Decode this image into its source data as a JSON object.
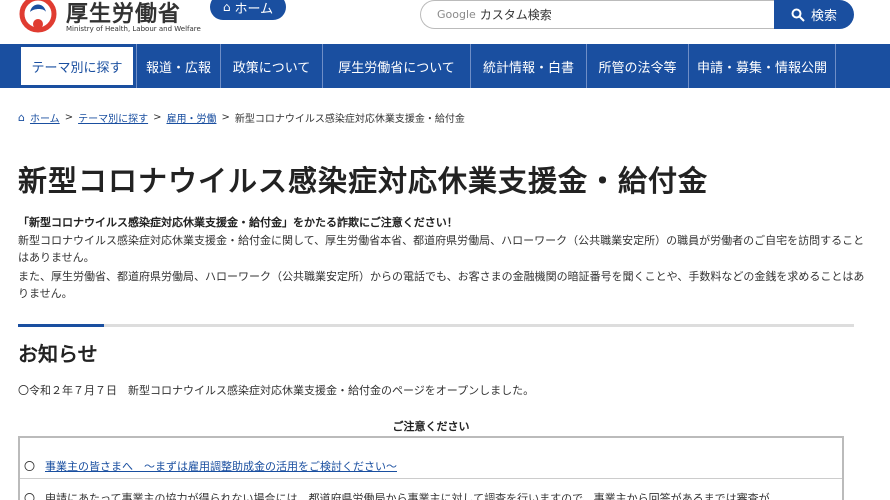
{
  "header": {
    "logo_text": "厚生労働省",
    "logo_sub": "Ministry of Health, Labour and Welfare",
    "home_label": "ホーム",
    "search_placeholder_brand": "Google",
    "search_placeholder": "カスタム検索",
    "search_button": "検索"
  },
  "gnav": {
    "items": [
      {
        "label": "テーマ別に探す"
      },
      {
        "label": "報道・広報"
      },
      {
        "label": "政策について"
      },
      {
        "label": "厚生労働省について"
      },
      {
        "label": "統計情報・白書"
      },
      {
        "label": "所管の法令等"
      },
      {
        "label": "申請・募集・情報公開"
      }
    ]
  },
  "breadcrumb": {
    "items": [
      "ホーム",
      "テーマ別に探す",
      "雇用・労働"
    ],
    "current": "新型コロナウイルス感染症対応休業支援金・給付金",
    "separator": ">"
  },
  "main": {
    "title": "新型コロナウイルス感染症対応休業支援金・給付金",
    "warning_heading": "「新型コロナウイルス感染症対応休業支援金・給付金」をかたる詐欺にご注意ください！",
    "warning_para1": "新型コロナウイルス感染症対応休業支援金・給付金に関して、厚生労働省本省、都道府県労働局、ハローワーク（公共職業安定所）の職員が労働者のご自宅を訪問することはありません。",
    "warning_para2": "また、厚生労働省、都道府県労働局、ハローワーク（公共職業安定所）からの電話でも、お客さまの金融機関の暗証番号を聞くことや、手数料などの金銭を求めることはありません。",
    "notice_title": "お知らせ",
    "notice_line": "〇令和２年７月７日　新型コロナウイルス感染症対応休業支援金・給付金のページをオープンしました。",
    "caution_heading": "ご注意ください",
    "caution_items": [
      {
        "bullet": "〇",
        "text": "事業主の皆さまへ　～まずは雇用調整助成金の活用をご検討ください～"
      },
      {
        "bullet": "〇",
        "text": "申請にあたって事業主の協力が得られない場合には、都道府県労働局から事業主に対して調査を行いますので、事業主から回答があるまでは審査が"
      }
    ]
  },
  "colors": {
    "brand_blue": "#1a4fa0",
    "logo_red": "#e03c31"
  }
}
